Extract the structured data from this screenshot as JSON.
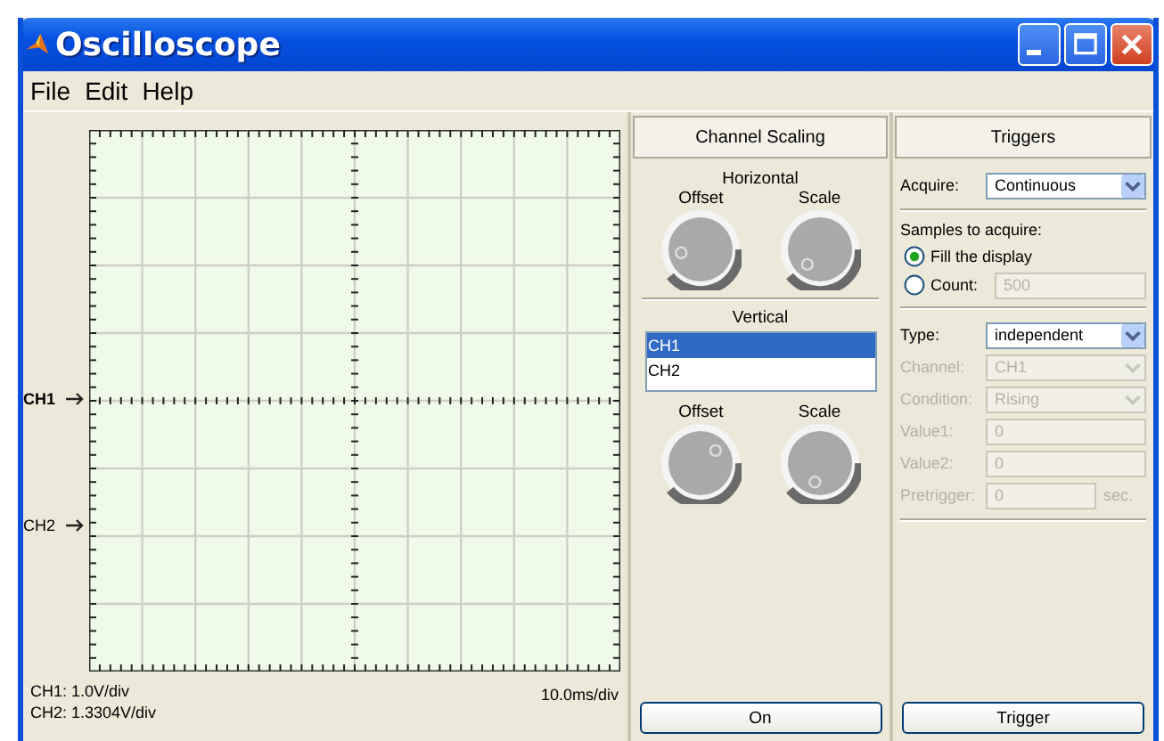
{
  "window": {
    "title": "Oscilloscope"
  },
  "menu": [
    "File",
    "Edit",
    "Help"
  ],
  "display": {
    "channel_markers": [
      {
        "label": "CH1"
      },
      {
        "label": "CH2"
      }
    ],
    "status": {
      "ch1": "CH1: 1.0V/div",
      "ch2": "CH2: 1.3304V/div",
      "time": "10.0ms/div"
    }
  },
  "channel_scaling": {
    "title": "Channel Scaling",
    "horizontal": {
      "label": "Horizontal",
      "knobs": [
        {
          "label": "Offset"
        },
        {
          "label": "Scale"
        }
      ]
    },
    "vertical": {
      "label": "Vertical",
      "channels": [
        {
          "label": "CH1",
          "selected": true
        },
        {
          "label": "CH2",
          "selected": false
        }
      ],
      "knobs": [
        {
          "label": "Offset"
        },
        {
          "label": "Scale"
        }
      ]
    },
    "button": "On"
  },
  "triggers": {
    "title": "Triggers",
    "acquire": {
      "label": "Acquire:",
      "value": "Continuous"
    },
    "samples_label": "Samples to acquire:",
    "samples_options": [
      {
        "label": "Fill the display",
        "selected": true
      },
      {
        "label": "Count:",
        "selected": false,
        "value": "500"
      }
    ],
    "fields": [
      {
        "label": "Type:",
        "value": "independent",
        "kind": "dropdown",
        "disabled": false
      },
      {
        "label": "Channel:",
        "value": "CH1",
        "kind": "dropdown",
        "disabled": true
      },
      {
        "label": "Condition:",
        "value": "Rising",
        "kind": "dropdown",
        "disabled": true
      },
      {
        "label": "Value1:",
        "value": "0",
        "kind": "text",
        "disabled": true
      },
      {
        "label": "Value2:",
        "value": "0",
        "kind": "text",
        "disabled": true
      },
      {
        "label": "Pretrigger:",
        "value": "0",
        "unit": "sec.",
        "kind": "text",
        "disabled": true
      }
    ],
    "button": "Trigger"
  }
}
